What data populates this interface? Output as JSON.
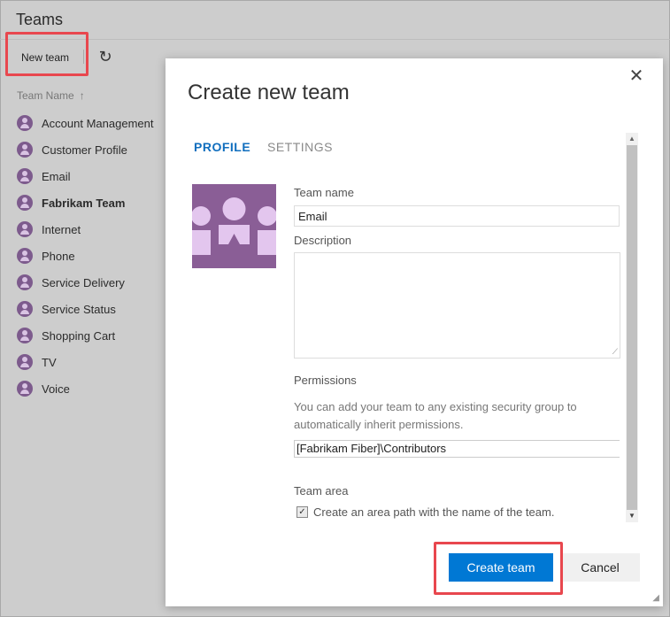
{
  "page": {
    "title": "Teams",
    "toolbar": {
      "new_team_label": "New team",
      "refresh_icon": "refresh-icon"
    },
    "column_header": "Team Name",
    "teams": [
      {
        "name": "Account Management",
        "tail": "a",
        "bold": false
      },
      {
        "name": "Customer Profile",
        "tail": "c",
        "bold": false
      },
      {
        "name": "Email",
        "tail": "e",
        "bold": false
      },
      {
        "name": "Fabrikam Team",
        "tail": "e",
        "bold": true
      },
      {
        "name": "Internet",
        "tail": "e",
        "bold": false
      },
      {
        "name": "Phone",
        "tail": "e",
        "bold": false
      },
      {
        "name": "Service Delivery",
        "tail": "a",
        "bold": false
      },
      {
        "name": "Service Status",
        "tail": "c",
        "bold": false
      },
      {
        "name": "Shopping Cart",
        "tail": "a",
        "bold": false
      },
      {
        "name": "TV",
        "tail": "e",
        "bold": false
      },
      {
        "name": "Voice",
        "tail": "c",
        "bold": false
      }
    ]
  },
  "dialog": {
    "title": "Create new team",
    "close_glyph": "✕",
    "tabs": {
      "profile": "PROFILE",
      "settings": "SETTINGS"
    },
    "team_name_label": "Team name",
    "team_name_value": "Email",
    "description_label": "Description",
    "description_value": "",
    "permissions_label": "Permissions",
    "permissions_help": "You can add your team to any existing security group to automatically inherit permissions.",
    "permissions_value": "[Fabrikam Fiber]\\Contributors",
    "team_area_label": "Team area",
    "team_area_checkbox_label": "Create an area path with the name of the team.",
    "team_area_checked": true,
    "create_label": "Create team",
    "cancel_label": "Cancel"
  },
  "colors": {
    "accent": "#0078d4",
    "active_tab": "#106ebe",
    "highlight": "#e8474e",
    "team_image": "#8a5e96",
    "team_image_figure": "#e3c6ee"
  }
}
